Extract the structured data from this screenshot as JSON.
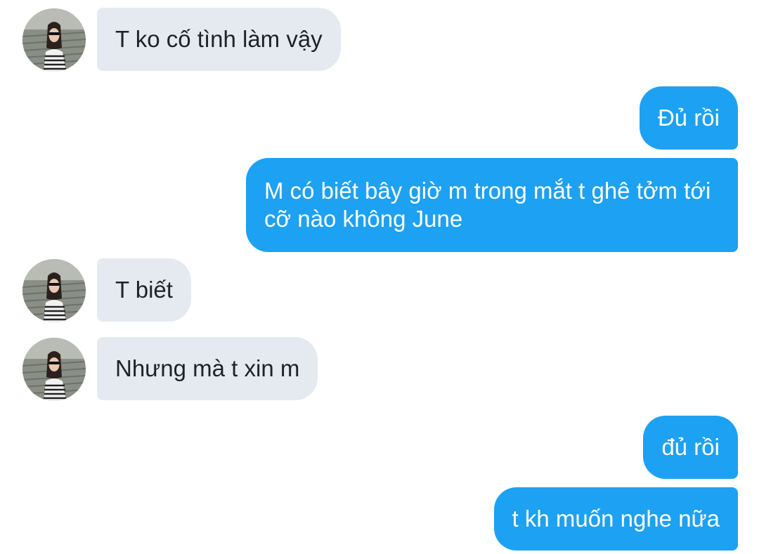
{
  "conversation": {
    "messages": [
      {
        "side": "incoming",
        "text": "T ko cố tình làm vậy"
      },
      {
        "side": "outgoing",
        "text": "Đủ rồi"
      },
      {
        "side": "outgoing",
        "text": "M có biết bây giờ m trong mắt t ghê tởm tới cỡ nào không June"
      },
      {
        "side": "incoming",
        "text": "T biết"
      },
      {
        "side": "incoming",
        "text": "Nhưng mà t xin m"
      },
      {
        "side": "outgoing",
        "text": "đủ rồi"
      },
      {
        "side": "outgoing",
        "text": "t kh muốn nghe nữa"
      }
    ]
  },
  "colors": {
    "incoming_bubble": "#e4eaf0",
    "outgoing_bubble": "#1da1f2"
  }
}
